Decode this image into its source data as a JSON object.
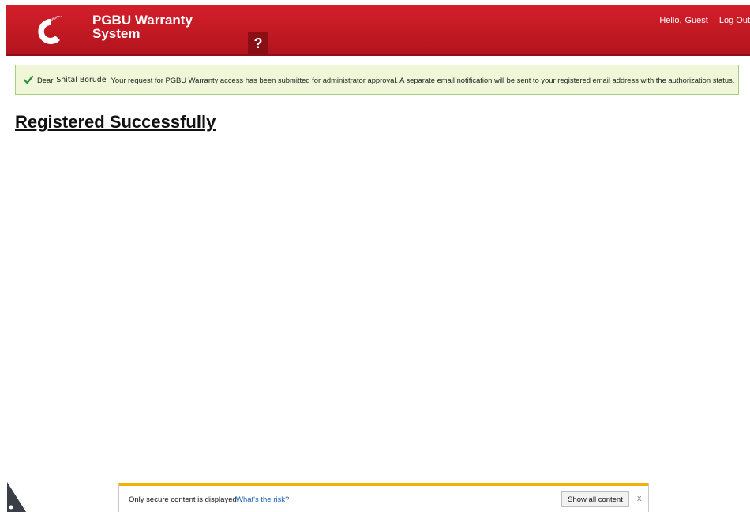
{
  "header": {
    "logo_text": "Cummins",
    "title_line1": "PGBU Warranty",
    "title_line2": "System",
    "help_label": "?",
    "greeting": "Hello,",
    "username": "Guest",
    "logout_label": "Log Out"
  },
  "notice": {
    "prefix": "Dear",
    "name": "Shital Borude",
    "message": "Your request for PGBU Warranty access has been submitted for administrator approval. A separate email notification will be sent to your registered email address with the authorization status."
  },
  "page": {
    "title": "Registered Successfully"
  },
  "infobar": {
    "message": "Only secure content is displayed.",
    "risk_link": "What's the risk?",
    "show_button": "Show all content",
    "close_label": "x"
  },
  "colors": {
    "header_red": "#c81a24",
    "notice_bg": "#eff7d8",
    "notice_border": "#a6cf85",
    "check_green": "#2e8b3a",
    "infobar_accent": "#f0b400"
  }
}
